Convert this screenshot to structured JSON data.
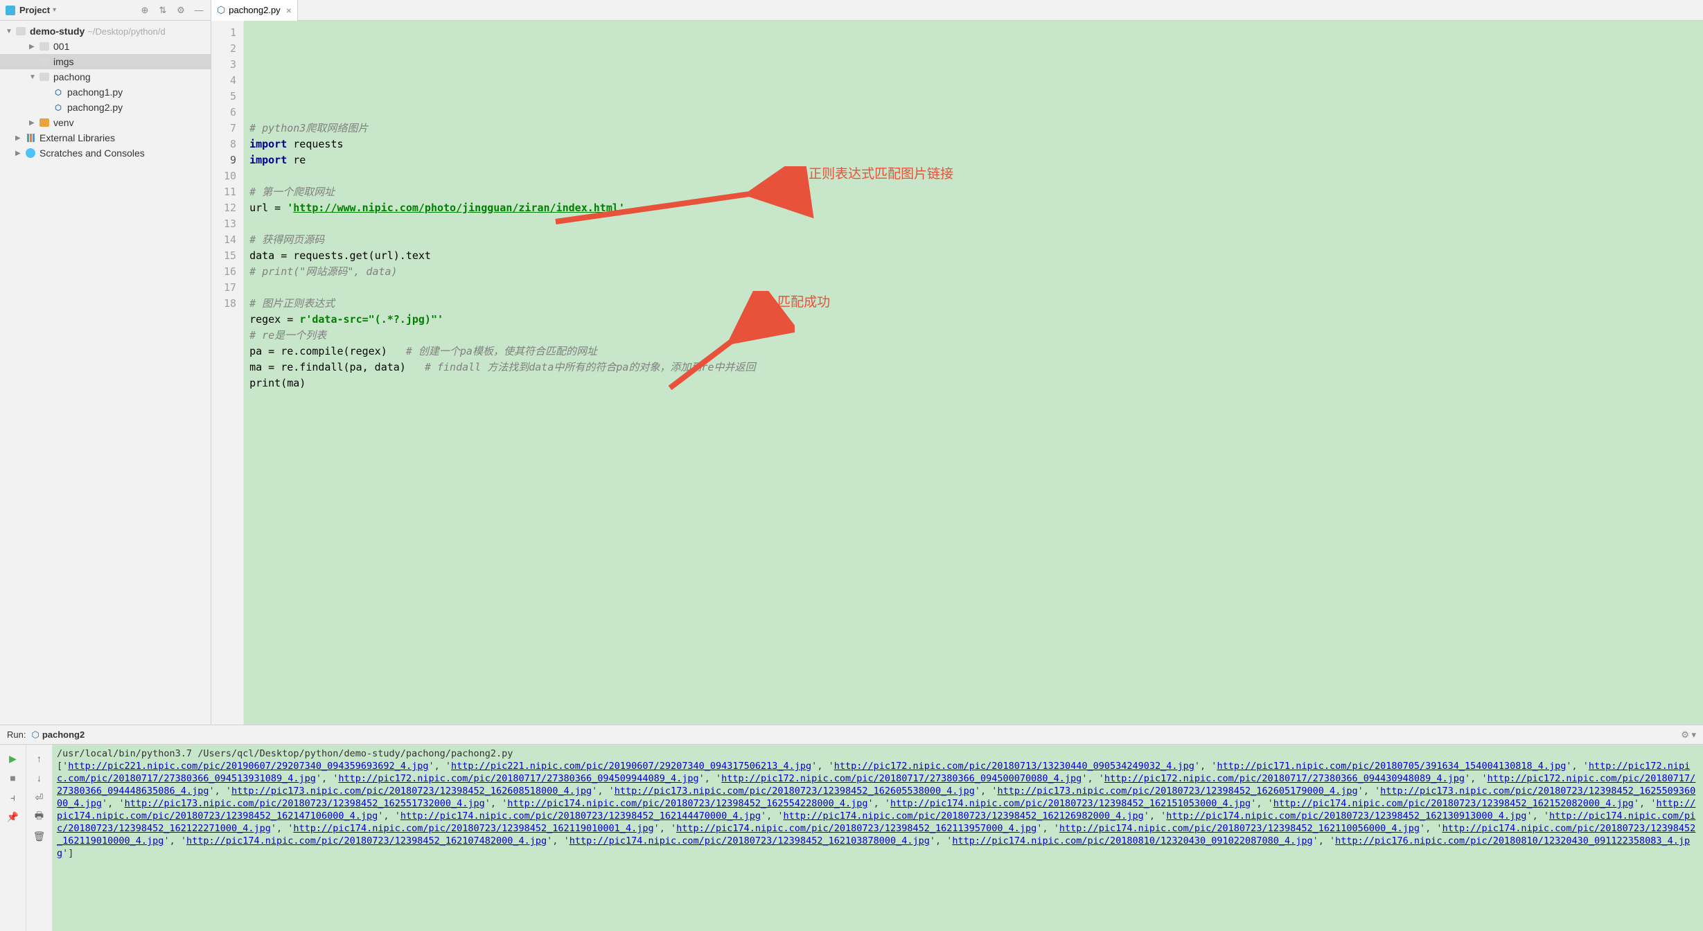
{
  "sidebar": {
    "title": "Project",
    "root": {
      "name": "demo-study",
      "path": "~/Desktop/python/d"
    },
    "items": [
      {
        "name": "001",
        "depth": 1,
        "icon": "folder",
        "arrow": "▶"
      },
      {
        "name": "imgs",
        "depth": 1,
        "icon": "folder",
        "selected": true
      },
      {
        "name": "pachong",
        "depth": 1,
        "icon": "folder",
        "arrow": "▼"
      },
      {
        "name": "pachong1.py",
        "depth": 2,
        "icon": "py"
      },
      {
        "name": "pachong2.py",
        "depth": 2,
        "icon": "py"
      },
      {
        "name": "venv",
        "depth": 1,
        "icon": "folder-orange",
        "arrow": "▶"
      },
      {
        "name": "External Libraries",
        "depth": 0,
        "icon": "lib",
        "arrow": "▶"
      },
      {
        "name": "Scratches and Consoles",
        "depth": 0,
        "icon": "scratch",
        "arrow": "▶"
      }
    ]
  },
  "tab": {
    "name": "pachong2.py"
  },
  "code": {
    "lines": [
      {
        "n": 1,
        "html": "<span class='cmt'># python3爬取网络图片</span>"
      },
      {
        "n": 2,
        "html": "<span class='kw'>import</span> requests"
      },
      {
        "n": 3,
        "html": "<span class='kw'>import</span> re"
      },
      {
        "n": 4,
        "html": ""
      },
      {
        "n": 5,
        "html": "<span class='cmt'># 第一个爬取网址</span>"
      },
      {
        "n": 6,
        "html": "url = <span class='str'>'<span class='url'>http://www.nipic.com/photo/jingguan/ziran/index.html</span>'</span>"
      },
      {
        "n": 7,
        "html": ""
      },
      {
        "n": 8,
        "html": "<span class='cmt'># 获得网页源码</span>"
      },
      {
        "n": 9,
        "html": "data = requests.get(url).text",
        "active": true
      },
      {
        "n": 10,
        "html": "<span class='cmt'># print(\"网站源码\", data)</span>"
      },
      {
        "n": 11,
        "html": ""
      },
      {
        "n": 12,
        "html": "<span class='cmt'># 图片正则表达式</span>"
      },
      {
        "n": 13,
        "html": "regex = <span class='str'>r'data-src=\"(.*?.jpg)\"'</span>"
      },
      {
        "n": 14,
        "html": "<span class='cmt'># re是一个列表</span>"
      },
      {
        "n": 15,
        "html": "pa = re.compile(regex)   <span class='cmt'># 创建一个pa模板，使其符合匹配的网址</span>"
      },
      {
        "n": 16,
        "html": "ma = re.findall(pa, data)   <span class='cmt'># findall 方法找到data中所有的符合pa的对象，添加到re中并返回</span>"
      },
      {
        "n": 17,
        "html": "<span class='fn'>print</span>(ma)"
      },
      {
        "n": 18,
        "html": ""
      }
    ]
  },
  "annotations": {
    "a1": "正则表达式匹配图片链接",
    "a2": "匹配成功"
  },
  "console": {
    "runLabel": "Run:",
    "runName": "pachong2",
    "cmdLine": "/usr/local/bin/python3.7 /Users/qcl/Desktop/python/demo-study/pachong/pachong2.py",
    "links": [
      "http://pic221.nipic.com/pic/20190607/29207340_094359693692_4.jpg",
      "http://pic221.nipic.com/pic/20190607/29207340_094317506213_4.jpg",
      "http://pic172.nipic.com/pic/20180713/13230440_090534249032_4.jpg",
      "http://pic171.nipic.com/pic/20180705/391634_154004130818_4.jpg",
      "http://pic172.nipic.com/pic/20180717/27380366_094513931089_4.jpg",
      "http://pic172.nipic.com/pic/20180717/27380366_094509944089_4.jpg",
      "http://pic172.nipic.com/pic/20180717/27380366_094500070080_4.jpg",
      "http://pic172.nipic.com/pic/20180717/27380366_094430948089_4.jpg",
      "http://pic172.nipic.com/pic/20180717/27380366_094448635086_4.jpg",
      "http://pic173.nipic.com/pic/20180723/12398452_162608518000_4.jpg",
      "http://pic173.nipic.com/pic/20180723/12398452_162605538000_4.jpg",
      "http://pic173.nipic.com/pic/20180723/12398452_162605179000_4.jpg",
      "http://pic173.nipic.com/pic/20180723/12398452_162550936000_4.jpg",
      "http://pic173.nipic.com/pic/20180723/12398452_162551732000_4.jpg",
      "http://pic174.nipic.com/pic/20180723/12398452_162554228000_4.jpg",
      "http://pic174.nipic.com/pic/20180723/12398452_162151053000_4.jpg",
      "http://pic174.nipic.com/pic/20180723/12398452_162152082000_4.jpg",
      "http://pic174.nipic.com/pic/20180723/12398452_162147106000_4.jpg",
      "http://pic174.nipic.com/pic/20180723/12398452_162144470000_4.jpg",
      "http://pic174.nipic.com/pic/20180723/12398452_162126982000_4.jpg",
      "http://pic174.nipic.com/pic/20180723/12398452_162130913000_4.jpg",
      "http://pic174.nipic.com/pic/20180723/12398452_162122271000_4.jpg",
      "http://pic174.nipic.com/pic/20180723/12398452_162119010001_4.jpg",
      "http://pic174.nipic.com/pic/20180723/12398452_162113957000_4.jpg",
      "http://pic174.nipic.com/pic/20180723/12398452_162110056000_4.jpg",
      "http://pic174.nipic.com/pic/20180723/12398452_162119010000_4.jpg",
      "http://pic174.nipic.com/pic/20180723/12398452_162107482000_4.jpg",
      "http://pic174.nipic.com/pic/20180723/12398452_162103878000_4.jpg",
      "http://pic174.nipic.com/pic/20180810/12320430_091022087080_4.jpg",
      "http://pic176.nipic.com/pic/20180810/12320430_091122358083_4.jpg"
    ]
  }
}
